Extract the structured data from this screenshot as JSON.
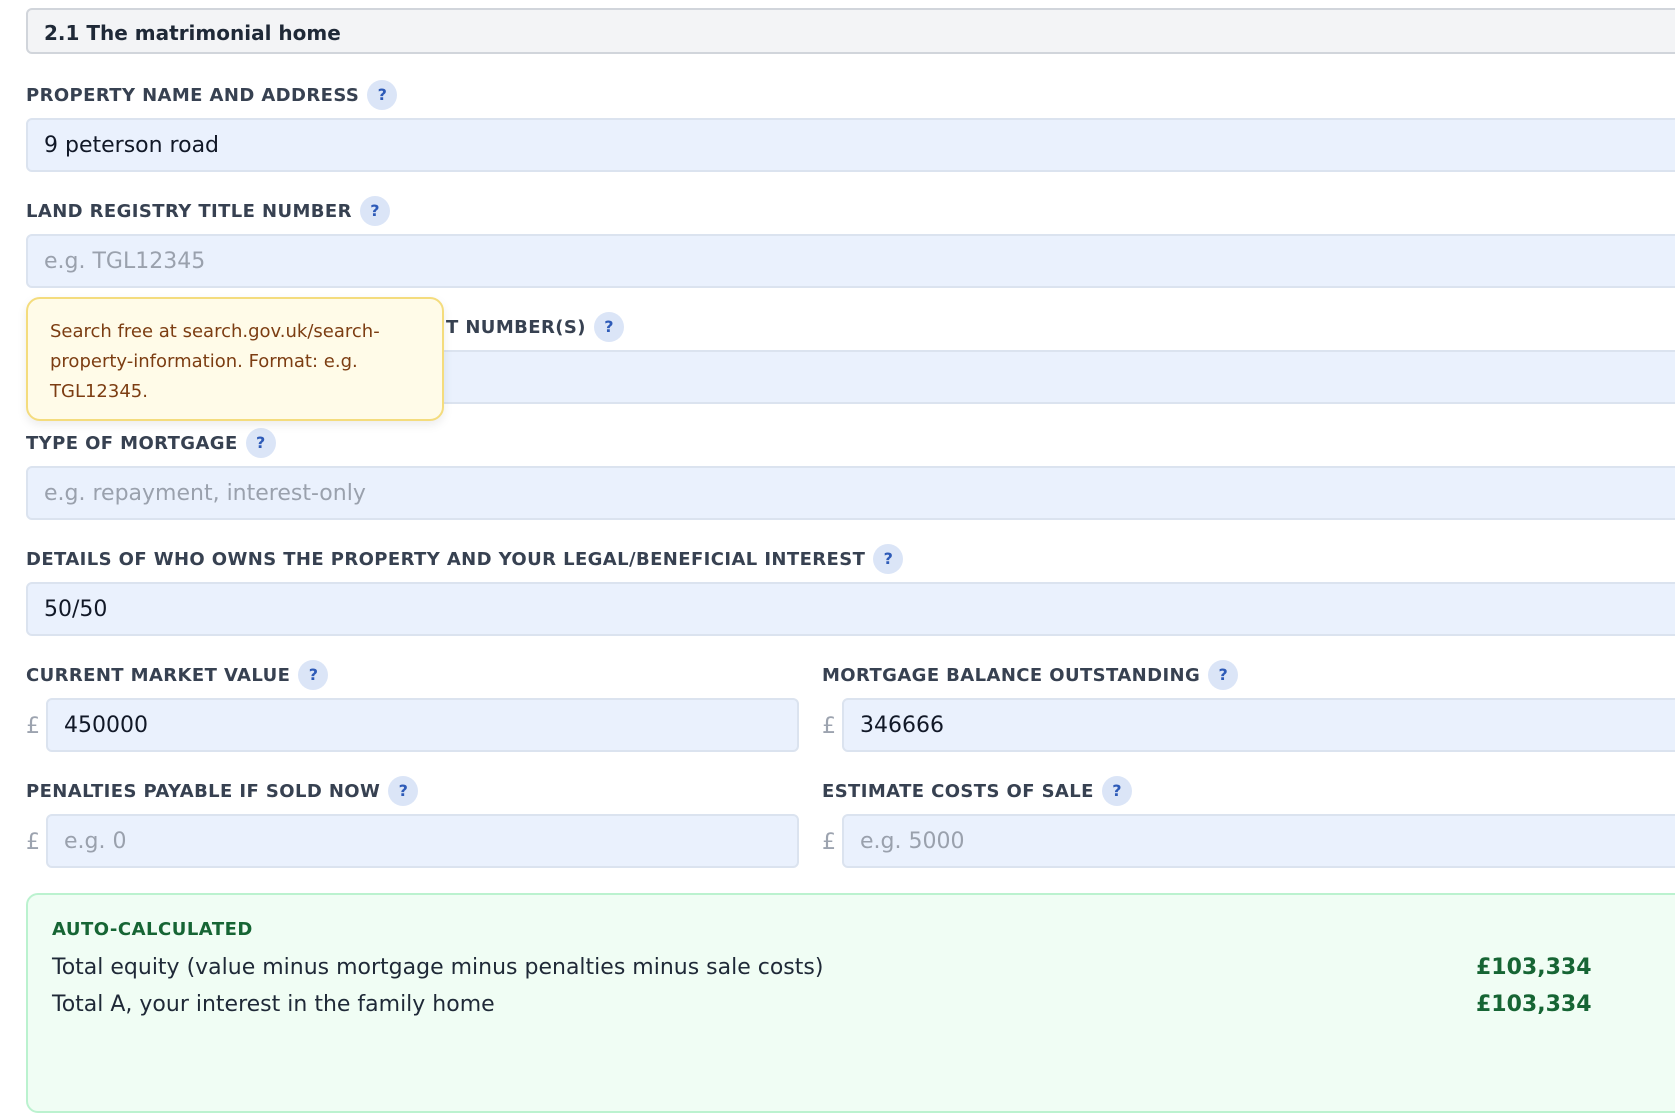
{
  "section": {
    "title": "2.1 The matrimonial home"
  },
  "help_glyph": "?",
  "fields": {
    "property_address": {
      "label": "PROPERTY NAME AND ADDRESS",
      "value": "9 peterson road",
      "placeholder": ""
    },
    "land_registry": {
      "label": "LAND REGISTRY TITLE NUMBER",
      "value": "",
      "placeholder": "e.g. TGL12345"
    },
    "mortgage_account": {
      "label_visible_part": "T NUMBER(S)",
      "value": "",
      "placeholder": ""
    },
    "mortgage_type": {
      "label": "TYPE OF MORTGAGE",
      "value": "",
      "placeholder": "e.g. repayment, interest-only"
    },
    "ownership": {
      "label": "DETAILS OF WHO OWNS THE PROPERTY AND YOUR LEGAL/BENEFICIAL INTEREST",
      "value": "50/50",
      "placeholder": ""
    },
    "market_value": {
      "label": "CURRENT MARKET VALUE",
      "currency": "£",
      "value": "450000",
      "placeholder": ""
    },
    "mortgage_balance": {
      "label": "MORTGAGE BALANCE OUTSTANDING",
      "currency": "£",
      "value": "346666",
      "placeholder": ""
    },
    "penalties": {
      "label": "PENALTIES PAYABLE IF SOLD NOW",
      "currency": "£",
      "value": "",
      "placeholder": "e.g. 0"
    },
    "sale_costs": {
      "label": "ESTIMATE COSTS OF SALE",
      "currency": "£",
      "value": "",
      "placeholder": "e.g. 5000"
    }
  },
  "tooltip": {
    "text": "Search free at search.gov.uk/search-property-information. Format: e.g. TGL12345."
  },
  "auto_calculated": {
    "title": "AUTO-CALCULATED",
    "rows": [
      {
        "label": "Total equity (value minus mortgage minus penalties minus sale costs)",
        "value": "£103,334"
      },
      {
        "label": "Total A, your interest in the family home",
        "value": "£103,334"
      }
    ]
  }
}
